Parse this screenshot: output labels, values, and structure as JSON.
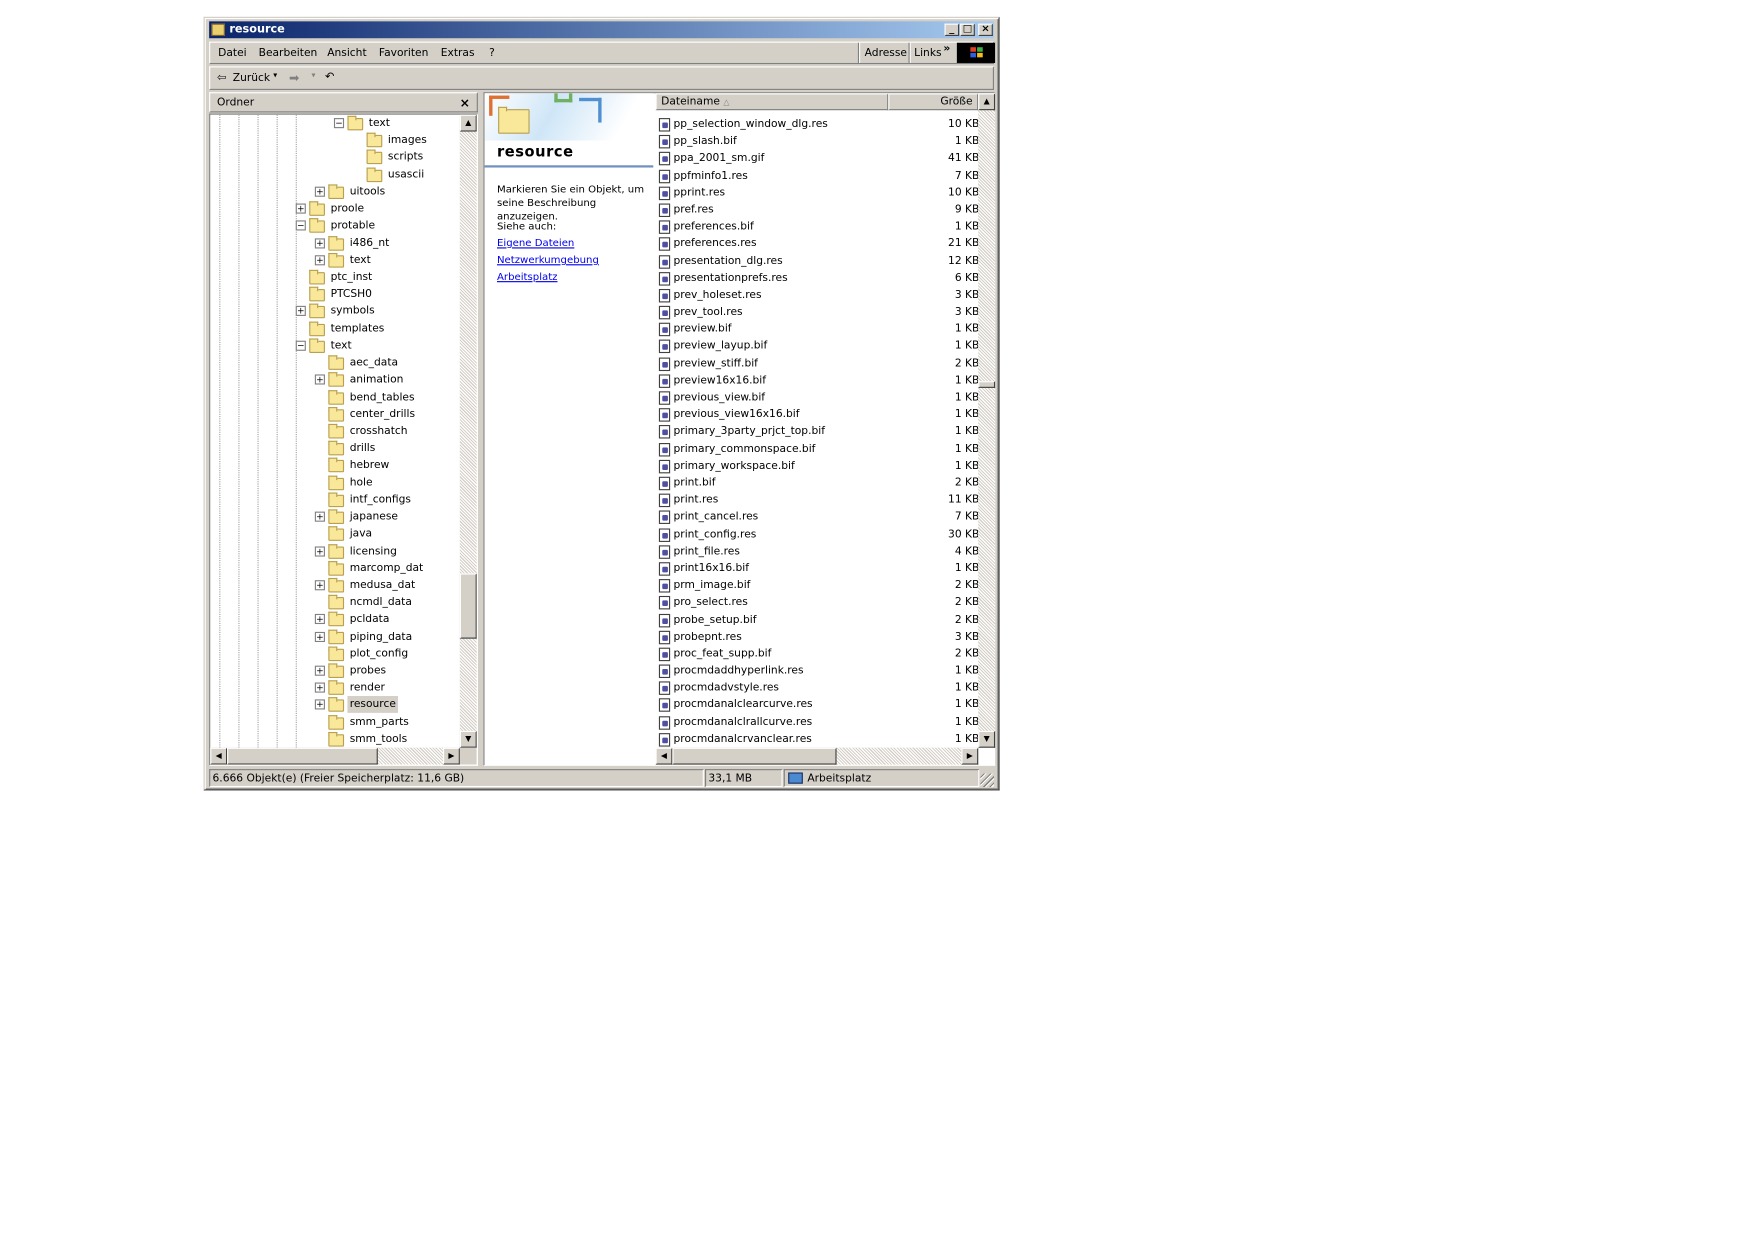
{
  "window": {
    "title": "resource"
  },
  "menu": {
    "items": [
      "Datei",
      "Bearbeiten",
      "Ansicht",
      "Favoriten",
      "Extras",
      "?"
    ],
    "address": "Adresse",
    "links": "Links",
    "chevron": "»"
  },
  "toolbar": {
    "back": "Zurück"
  },
  "folders": {
    "header": "Ordner",
    "close": "×",
    "tree": [
      {
        "label": "text",
        "level": 2,
        "exp": "-"
      },
      {
        "label": "images",
        "level": 3,
        "exp": ""
      },
      {
        "label": "scripts",
        "level": 3,
        "exp": ""
      },
      {
        "label": "usascii",
        "level": 3,
        "exp": ""
      },
      {
        "label": "uitools",
        "level": 1,
        "exp": "+"
      },
      {
        "label": "proole",
        "level": 0,
        "exp": "+"
      },
      {
        "label": "protable",
        "level": 0,
        "exp": "-"
      },
      {
        "label": "i486_nt",
        "level": 1,
        "exp": "+"
      },
      {
        "label": "text",
        "level": 1,
        "exp": "+"
      },
      {
        "label": "ptc_inst",
        "level": 0,
        "exp": ""
      },
      {
        "label": "PTCSH0",
        "level": 0,
        "exp": ""
      },
      {
        "label": "symbols",
        "level": 0,
        "exp": "+"
      },
      {
        "label": "templates",
        "level": 0,
        "exp": ""
      },
      {
        "label": "text",
        "level": 0,
        "exp": "-"
      },
      {
        "label": "aec_data",
        "level": 1,
        "exp": ""
      },
      {
        "label": "animation",
        "level": 1,
        "exp": "+"
      },
      {
        "label": "bend_tables",
        "level": 1,
        "exp": ""
      },
      {
        "label": "center_drills",
        "level": 1,
        "exp": ""
      },
      {
        "label": "crosshatch",
        "level": 1,
        "exp": ""
      },
      {
        "label": "drills",
        "level": 1,
        "exp": ""
      },
      {
        "label": "hebrew",
        "level": 1,
        "exp": ""
      },
      {
        "label": "hole",
        "level": 1,
        "exp": ""
      },
      {
        "label": "intf_configs",
        "level": 1,
        "exp": ""
      },
      {
        "label": "japanese",
        "level": 1,
        "exp": "+"
      },
      {
        "label": "java",
        "level": 1,
        "exp": ""
      },
      {
        "label": "licensing",
        "level": 1,
        "exp": "+"
      },
      {
        "label": "marcomp_dat",
        "level": 1,
        "exp": ""
      },
      {
        "label": "medusa_dat",
        "level": 1,
        "exp": "+"
      },
      {
        "label": "ncmdl_data",
        "level": 1,
        "exp": ""
      },
      {
        "label": "pcldata",
        "level": 1,
        "exp": "+"
      },
      {
        "label": "piping_data",
        "level": 1,
        "exp": "+"
      },
      {
        "label": "plot_config",
        "level": 1,
        "exp": ""
      },
      {
        "label": "probes",
        "level": 1,
        "exp": "+"
      },
      {
        "label": "render",
        "level": 1,
        "exp": "+"
      },
      {
        "label": "resource",
        "level": 1,
        "exp": "+",
        "selected": true
      },
      {
        "label": "smm_parts",
        "level": 1,
        "exp": ""
      },
      {
        "label": "smm_tools",
        "level": 1,
        "exp": ""
      }
    ]
  },
  "webview": {
    "title": "resource",
    "hint": "Markieren Sie ein Objekt, um seine Beschreibung anzuzeigen.",
    "see_also": "Siehe auch:",
    "links": [
      "Eigene Dateien",
      "Netzwerkumgebung",
      "Arbeitsplatz"
    ]
  },
  "list": {
    "col_name": "Dateiname",
    "col_size": "Größe",
    "files": [
      {
        "name": "pp_selection_window_dlg.res",
        "size": "10 KB"
      },
      {
        "name": "pp_slash.bif",
        "size": "1 KB"
      },
      {
        "name": "ppa_2001_sm.gif",
        "size": "41 KB"
      },
      {
        "name": "ppfminfo1.res",
        "size": "7 KB"
      },
      {
        "name": "pprint.res",
        "size": "10 KB"
      },
      {
        "name": "pref.res",
        "size": "9 KB"
      },
      {
        "name": "preferences.bif",
        "size": "1 KB"
      },
      {
        "name": "preferences.res",
        "size": "21 KB"
      },
      {
        "name": "presentation_dlg.res",
        "size": "12 KB"
      },
      {
        "name": "presentationprefs.res",
        "size": "6 KB"
      },
      {
        "name": "prev_holeset.res",
        "size": "3 KB"
      },
      {
        "name": "prev_tool.res",
        "size": "3 KB"
      },
      {
        "name": "preview.bif",
        "size": "1 KB"
      },
      {
        "name": "preview_layup.bif",
        "size": "1 KB"
      },
      {
        "name": "preview_stiff.bif",
        "size": "2 KB"
      },
      {
        "name": "preview16x16.bif",
        "size": "1 KB"
      },
      {
        "name": "previous_view.bif",
        "size": "1 KB"
      },
      {
        "name": "previous_view16x16.bif",
        "size": "1 KB"
      },
      {
        "name": "primary_3party_prjct_top.bif",
        "size": "1 KB"
      },
      {
        "name": "primary_commonspace.bif",
        "size": "1 KB"
      },
      {
        "name": "primary_workspace.bif",
        "size": "1 KB"
      },
      {
        "name": "print.bif",
        "size": "2 KB"
      },
      {
        "name": "print.res",
        "size": "11 KB"
      },
      {
        "name": "print_cancel.res",
        "size": "7 KB"
      },
      {
        "name": "print_config.res",
        "size": "30 KB"
      },
      {
        "name": "print_file.res",
        "size": "4 KB"
      },
      {
        "name": "print16x16.bif",
        "size": "1 KB"
      },
      {
        "name": "prm_image.bif",
        "size": "2 KB"
      },
      {
        "name": "pro_select.res",
        "size": "2 KB"
      },
      {
        "name": "probe_setup.bif",
        "size": "2 KB"
      },
      {
        "name": "probepnt.res",
        "size": "3 KB"
      },
      {
        "name": "proc_feat_supp.bif",
        "size": "2 KB"
      },
      {
        "name": "procmdaddhyperlink.res",
        "size": "1 KB"
      },
      {
        "name": "procmdadvstyle.res",
        "size": "1 KB"
      },
      {
        "name": "procmdanalclearcurve.res",
        "size": "1 KB"
      },
      {
        "name": "procmdanalclrallcurve.res",
        "size": "1 KB"
      },
      {
        "name": "procmdanalcrvanclear.res",
        "size": "1 KB"
      }
    ]
  },
  "status": {
    "objects": "6.666 Objekt(e)  (Freier Speicherplatz: 11,6 GB)",
    "size": "33,1 MB",
    "zone": "Arbeitsplatz"
  }
}
